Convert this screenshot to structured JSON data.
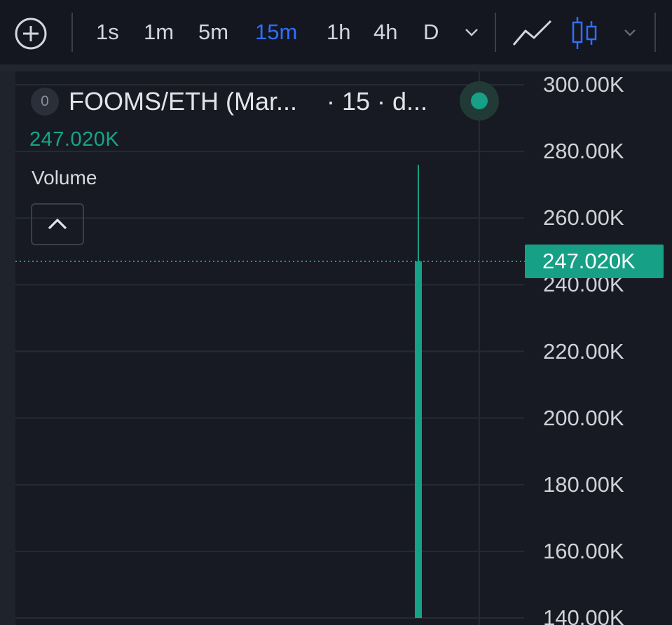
{
  "toolbar": {
    "add_icon": "plus-circle-icon",
    "timeframes": [
      {
        "label": "1s",
        "active": false
      },
      {
        "label": "1m",
        "active": false
      },
      {
        "label": "5m",
        "active": false
      },
      {
        "label": "15m",
        "active": true
      },
      {
        "label": "1h",
        "active": false
      },
      {
        "label": "4h",
        "active": false
      },
      {
        "label": "D",
        "active": false
      }
    ],
    "timeframe_dropdown_icon": "chevron-down-icon",
    "line_chart_icon": "line-chart-icon",
    "candle_chart_icon": "candlestick-icon",
    "chart_type_dropdown_icon": "chevron-down-icon",
    "active_color": "#2f6fff"
  },
  "legend": {
    "badge": "0",
    "pair": "FOOMS/ETH (Mar...",
    "meta": "· 15 · d...",
    "status_color": "#16a085",
    "last_price": "247.020K",
    "volume_label": "Volume",
    "collapse_icon": "chevron-up-icon"
  },
  "axis": {
    "labels": [
      "300.00K",
      "280.00K",
      "260.00K",
      "240.00K",
      "220.00K",
      "200.00K",
      "180.00K",
      "160.00K",
      "140.00K"
    ],
    "current_price_tag": "247.020K",
    "up_color": "#16a085"
  },
  "chart_data": {
    "type": "candlestick",
    "ylim": [
      140000,
      300000
    ],
    "y_ticks": [
      300000,
      280000,
      260000,
      240000,
      220000,
      200000,
      180000,
      160000,
      140000
    ],
    "last_price": 247020,
    "candles": [
      {
        "open": 140000,
        "close": 247020,
        "high": 276000,
        "low": 140000
      }
    ],
    "grid": true
  }
}
